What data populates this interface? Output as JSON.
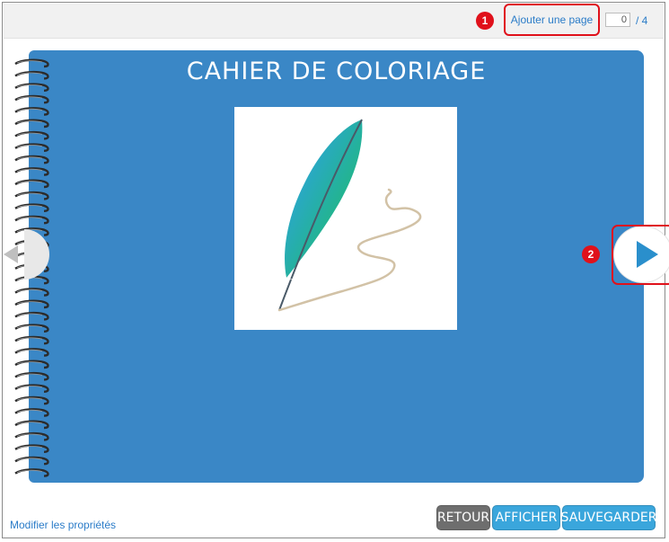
{
  "toolbar": {
    "add_page_label": "Ajouter une page",
    "page_current": "0",
    "page_total": "/ 4",
    "annotation_1": "1"
  },
  "notebook": {
    "title": "CAHIER DE COLORIAGE",
    "background": "#3a87c6",
    "illustration_icon": "feather-quill-icon"
  },
  "navigation": {
    "prev_icon": "chevron-left-icon",
    "next_icon": "play-arrow-right-icon",
    "annotation_2": "2"
  },
  "footer": {
    "properties_link": "Modifier les propriétés",
    "buttons": {
      "retour": "RETOUR",
      "afficher": "AFFICHER",
      "sauvegarder": "SAUVEGARDER"
    }
  },
  "colors": {
    "accent": "#2b7cc8",
    "highlight": "#e0111b",
    "button": "#3aa6dc",
    "button_muted": "#6e6e6e"
  }
}
